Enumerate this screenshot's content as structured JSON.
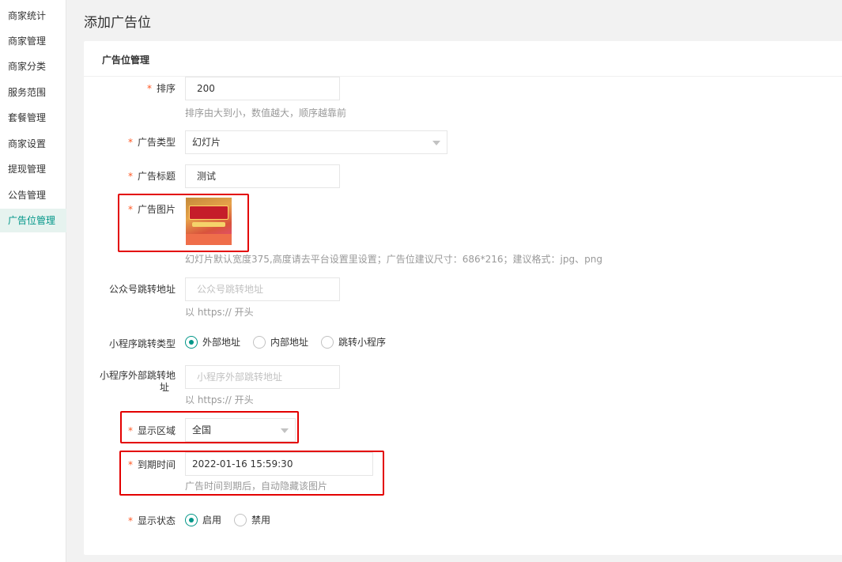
{
  "sidebar": {
    "items": [
      {
        "label": "商家统计"
      },
      {
        "label": "商家管理"
      },
      {
        "label": "商家分类"
      },
      {
        "label": "服务范围"
      },
      {
        "label": "套餐管理"
      },
      {
        "label": "商家设置"
      },
      {
        "label": "提现管理"
      },
      {
        "label": "公告管理"
      },
      {
        "label": "广告位管理",
        "active": true
      }
    ]
  },
  "page": {
    "title": "添加广告位"
  },
  "card": {
    "title": "广告位管理"
  },
  "required_mark": "*",
  "form": {
    "sort": {
      "label": "排序",
      "value": "200",
      "hint": "排序由大到小，数值越大，顺序越靠前"
    },
    "ad_type": {
      "label": "广告类型",
      "value": "幻灯片"
    },
    "ad_title": {
      "label": "广告标题",
      "value": "测试"
    },
    "ad_image": {
      "label": "广告图片",
      "hint": "幻灯片默认宽度375,高度请去平台设置里设置；广告位建议尺寸：686*216；建议格式：jpg、png"
    },
    "mp_url": {
      "label": "公众号跳转地址",
      "placeholder": "公众号跳转地址",
      "hint": "以 https:// 开头"
    },
    "mini_jump_type": {
      "label": "小程序跳转类型",
      "options": [
        "外部地址",
        "内部地址",
        "跳转小程序"
      ],
      "selected": "外部地址"
    },
    "mini_ext_url": {
      "label_line1": "小程序外部跳转地",
      "label_line2": "址",
      "placeholder": "小程序外部跳转地址",
      "hint": "以 https:// 开头"
    },
    "display_region": {
      "label": "显示区域",
      "value": "全国"
    },
    "expire_time": {
      "label": "到期时间",
      "value": "2022-01-16 15:59:30",
      "hint": "广告时间到期后，自动隐藏该图片"
    },
    "display_status": {
      "label": "显示状态",
      "options": [
        "启用",
        "禁用"
      ],
      "selected": "启用"
    }
  },
  "colors": {
    "accent": "#009688",
    "required": "#ff5722",
    "highlight": "#e30000"
  }
}
